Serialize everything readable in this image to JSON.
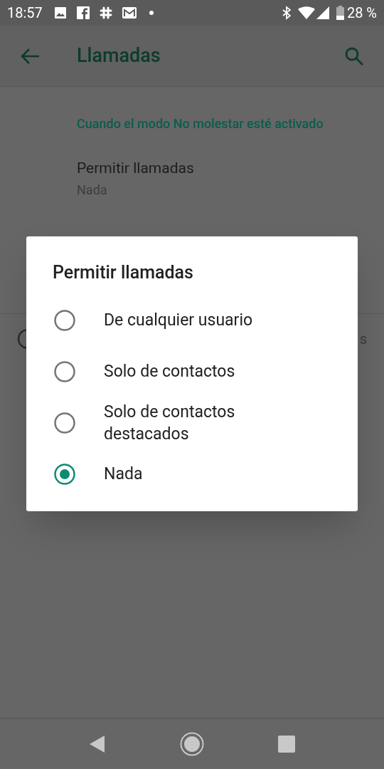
{
  "status_bar": {
    "time": "18:57",
    "battery": "28 %"
  },
  "app_bar": {
    "title": "Llamadas"
  },
  "section_header": "Cuando el modo No molestar esté activado",
  "setting": {
    "title": "Permitir llamadas",
    "value": "Nada"
  },
  "covered_row": {
    "text_fragment": "s"
  },
  "dialog": {
    "title": "Permitir llamadas",
    "options": [
      {
        "label": "De cualquier usuario",
        "selected": false
      },
      {
        "label": "Solo de contactos",
        "selected": false
      },
      {
        "label": "Solo de contactos destacados",
        "selected": false
      },
      {
        "label": "Nada",
        "selected": true
      }
    ]
  }
}
